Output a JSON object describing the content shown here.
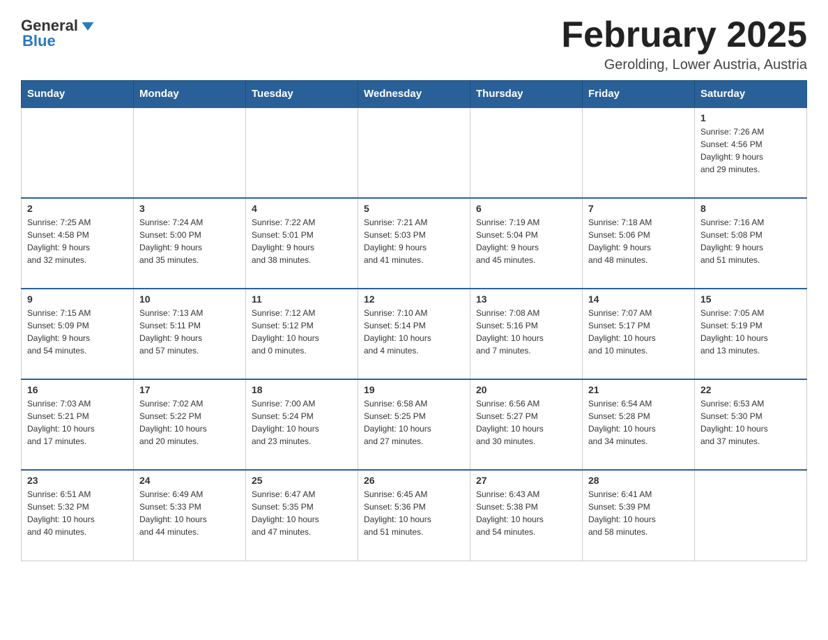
{
  "header": {
    "logo": {
      "text_general": "General",
      "text_blue": "Blue",
      "arrow_color": "#2a7abf"
    },
    "title": "February 2025",
    "subtitle": "Gerolding, Lower Austria, Austria"
  },
  "weekdays": [
    "Sunday",
    "Monday",
    "Tuesday",
    "Wednesday",
    "Thursday",
    "Friday",
    "Saturday"
  ],
  "weeks": [
    [
      {
        "day": "",
        "info": ""
      },
      {
        "day": "",
        "info": ""
      },
      {
        "day": "",
        "info": ""
      },
      {
        "day": "",
        "info": ""
      },
      {
        "day": "",
        "info": ""
      },
      {
        "day": "",
        "info": ""
      },
      {
        "day": "1",
        "info": "Sunrise: 7:26 AM\nSunset: 4:56 PM\nDaylight: 9 hours\nand 29 minutes."
      }
    ],
    [
      {
        "day": "2",
        "info": "Sunrise: 7:25 AM\nSunset: 4:58 PM\nDaylight: 9 hours\nand 32 minutes."
      },
      {
        "day": "3",
        "info": "Sunrise: 7:24 AM\nSunset: 5:00 PM\nDaylight: 9 hours\nand 35 minutes."
      },
      {
        "day": "4",
        "info": "Sunrise: 7:22 AM\nSunset: 5:01 PM\nDaylight: 9 hours\nand 38 minutes."
      },
      {
        "day": "5",
        "info": "Sunrise: 7:21 AM\nSunset: 5:03 PM\nDaylight: 9 hours\nand 41 minutes."
      },
      {
        "day": "6",
        "info": "Sunrise: 7:19 AM\nSunset: 5:04 PM\nDaylight: 9 hours\nand 45 minutes."
      },
      {
        "day": "7",
        "info": "Sunrise: 7:18 AM\nSunset: 5:06 PM\nDaylight: 9 hours\nand 48 minutes."
      },
      {
        "day": "8",
        "info": "Sunrise: 7:16 AM\nSunset: 5:08 PM\nDaylight: 9 hours\nand 51 minutes."
      }
    ],
    [
      {
        "day": "9",
        "info": "Sunrise: 7:15 AM\nSunset: 5:09 PM\nDaylight: 9 hours\nand 54 minutes."
      },
      {
        "day": "10",
        "info": "Sunrise: 7:13 AM\nSunset: 5:11 PM\nDaylight: 9 hours\nand 57 minutes."
      },
      {
        "day": "11",
        "info": "Sunrise: 7:12 AM\nSunset: 5:12 PM\nDaylight: 10 hours\nand 0 minutes."
      },
      {
        "day": "12",
        "info": "Sunrise: 7:10 AM\nSunset: 5:14 PM\nDaylight: 10 hours\nand 4 minutes."
      },
      {
        "day": "13",
        "info": "Sunrise: 7:08 AM\nSunset: 5:16 PM\nDaylight: 10 hours\nand 7 minutes."
      },
      {
        "day": "14",
        "info": "Sunrise: 7:07 AM\nSunset: 5:17 PM\nDaylight: 10 hours\nand 10 minutes."
      },
      {
        "day": "15",
        "info": "Sunrise: 7:05 AM\nSunset: 5:19 PM\nDaylight: 10 hours\nand 13 minutes."
      }
    ],
    [
      {
        "day": "16",
        "info": "Sunrise: 7:03 AM\nSunset: 5:21 PM\nDaylight: 10 hours\nand 17 minutes."
      },
      {
        "day": "17",
        "info": "Sunrise: 7:02 AM\nSunset: 5:22 PM\nDaylight: 10 hours\nand 20 minutes."
      },
      {
        "day": "18",
        "info": "Sunrise: 7:00 AM\nSunset: 5:24 PM\nDaylight: 10 hours\nand 23 minutes."
      },
      {
        "day": "19",
        "info": "Sunrise: 6:58 AM\nSunset: 5:25 PM\nDaylight: 10 hours\nand 27 minutes."
      },
      {
        "day": "20",
        "info": "Sunrise: 6:56 AM\nSunset: 5:27 PM\nDaylight: 10 hours\nand 30 minutes."
      },
      {
        "day": "21",
        "info": "Sunrise: 6:54 AM\nSunset: 5:28 PM\nDaylight: 10 hours\nand 34 minutes."
      },
      {
        "day": "22",
        "info": "Sunrise: 6:53 AM\nSunset: 5:30 PM\nDaylight: 10 hours\nand 37 minutes."
      }
    ],
    [
      {
        "day": "23",
        "info": "Sunrise: 6:51 AM\nSunset: 5:32 PM\nDaylight: 10 hours\nand 40 minutes."
      },
      {
        "day": "24",
        "info": "Sunrise: 6:49 AM\nSunset: 5:33 PM\nDaylight: 10 hours\nand 44 minutes."
      },
      {
        "day": "25",
        "info": "Sunrise: 6:47 AM\nSunset: 5:35 PM\nDaylight: 10 hours\nand 47 minutes."
      },
      {
        "day": "26",
        "info": "Sunrise: 6:45 AM\nSunset: 5:36 PM\nDaylight: 10 hours\nand 51 minutes."
      },
      {
        "day": "27",
        "info": "Sunrise: 6:43 AM\nSunset: 5:38 PM\nDaylight: 10 hours\nand 54 minutes."
      },
      {
        "day": "28",
        "info": "Sunrise: 6:41 AM\nSunset: 5:39 PM\nDaylight: 10 hours\nand 58 minutes."
      },
      {
        "day": "",
        "info": ""
      }
    ]
  ]
}
